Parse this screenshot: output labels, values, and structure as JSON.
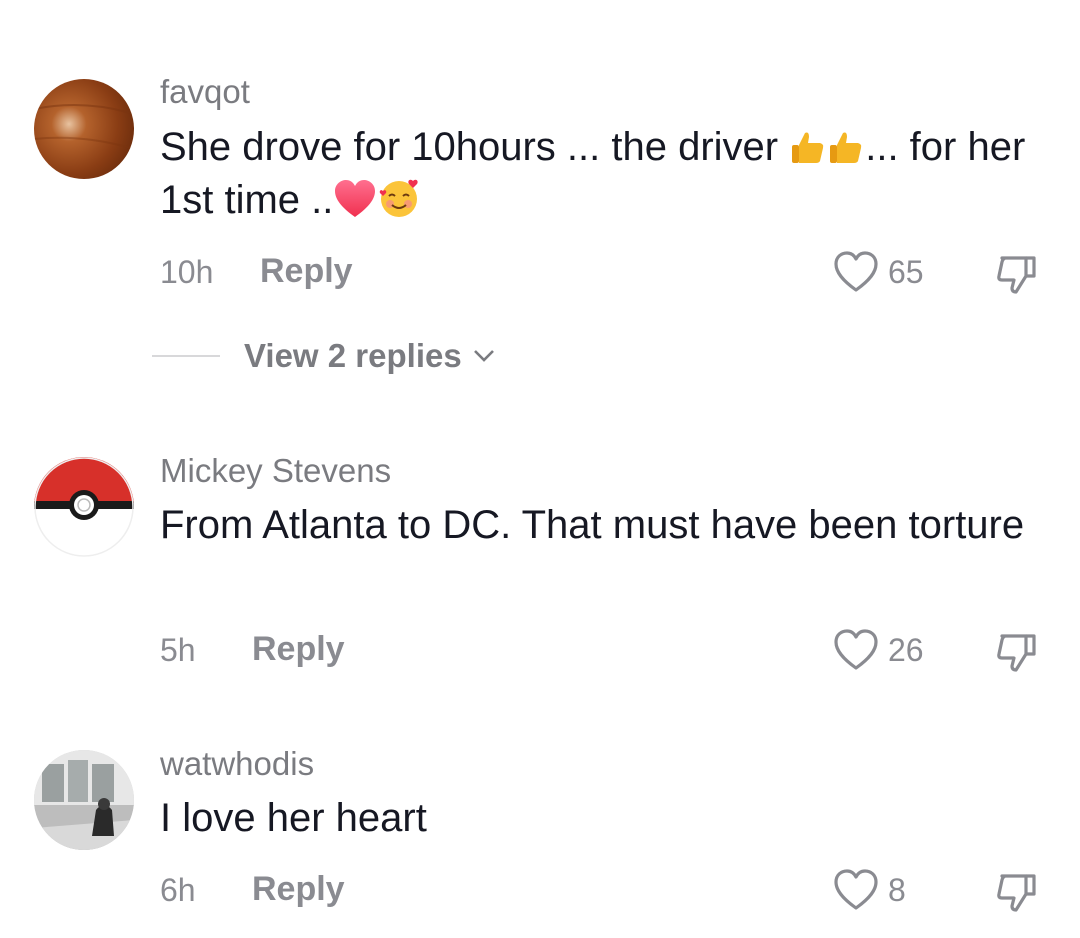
{
  "comments": [
    {
      "username": "favqot",
      "text_parts": [
        "She drove for 10hours ... the driver ",
        "... for her 1st time .."
      ],
      "time": "10h",
      "reply_label": "Reply",
      "likes": "65",
      "avatar_icon": "wood-avatar-icon",
      "view_replies": "View 2 replies"
    },
    {
      "username": "Mickey Stevens",
      "text": "From Atlanta to DC. That must have been torture",
      "time": "5h",
      "reply_label": "Reply",
      "likes": "26",
      "avatar_icon": "pokeball-avatar-icon"
    },
    {
      "username": "watwhodis",
      "text": "I love her heart",
      "time": "6h",
      "reply_label": "Reply",
      "likes": "8",
      "avatar_icon": "room-photo-avatar-icon"
    }
  ],
  "colors": {
    "text": "#161823",
    "muted": "#8a8b91",
    "background": "#ffffff"
  }
}
